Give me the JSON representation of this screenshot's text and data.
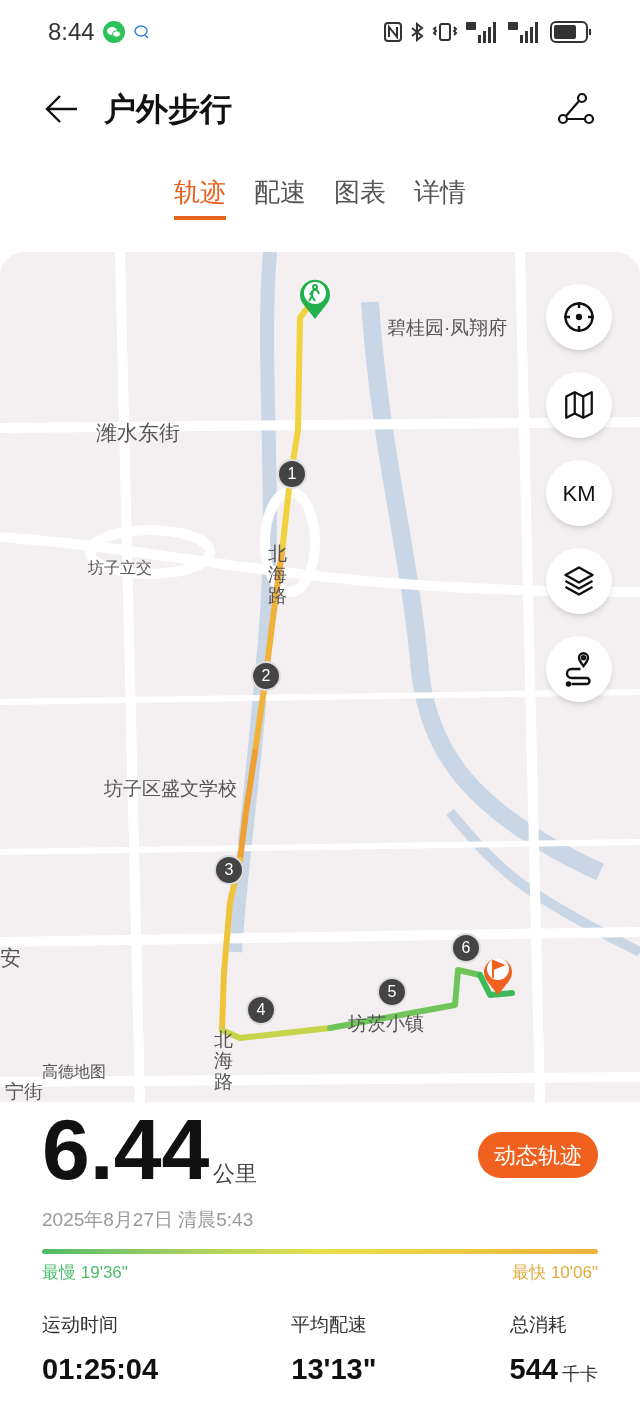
{
  "status_bar": {
    "time": "8:44"
  },
  "header": {
    "title": "户外步行"
  },
  "tabs": [
    {
      "label": "轨迹",
      "selected": true
    },
    {
      "label": "配速",
      "selected": false
    },
    {
      "label": "图表",
      "selected": false
    },
    {
      "label": "详情",
      "selected": false
    }
  ],
  "map": {
    "labels": [
      {
        "text": "碧桂园·凤翔府",
        "kind": "place"
      },
      {
        "text": "潍水东街",
        "kind": "road"
      },
      {
        "text": "坊子立交",
        "kind": "small"
      },
      {
        "text": "北海路",
        "kind": "vertical"
      },
      {
        "text": "坊子区盛文学校",
        "kind": "place"
      },
      {
        "text": "安",
        "kind": "road"
      },
      {
        "text": "坊茨小镇",
        "kind": "place"
      },
      {
        "text": "北海路",
        "kind": "vertical"
      },
      {
        "text": "高德地图",
        "kind": "small"
      },
      {
        "text": "宁街",
        "kind": "place"
      }
    ],
    "markers": [
      {
        "label": "1"
      },
      {
        "label": "2"
      },
      {
        "label": "3"
      },
      {
        "label": "4"
      },
      {
        "label": "5"
      },
      {
        "label": "6"
      }
    ],
    "controls": [
      {
        "kind": "locate"
      },
      {
        "kind": "map"
      },
      {
        "kind": "units",
        "label": "KM"
      },
      {
        "kind": "layers"
      },
      {
        "kind": "route"
      }
    ]
  },
  "stats": {
    "distance": "6.44",
    "distance_unit": "公里",
    "button": "动态轨迹",
    "date": "2025年8月27日 清晨5:43",
    "slowest": "最慢 19'36\"",
    "fastest": "最快 10'06\"",
    "metrics": [
      {
        "label": "运动时间",
        "value": "01:25:04"
      },
      {
        "label": "平均配速",
        "value": "13'13\""
      },
      {
        "label": "总消耗",
        "value": "544",
        "unit": "千卡"
      }
    ]
  }
}
